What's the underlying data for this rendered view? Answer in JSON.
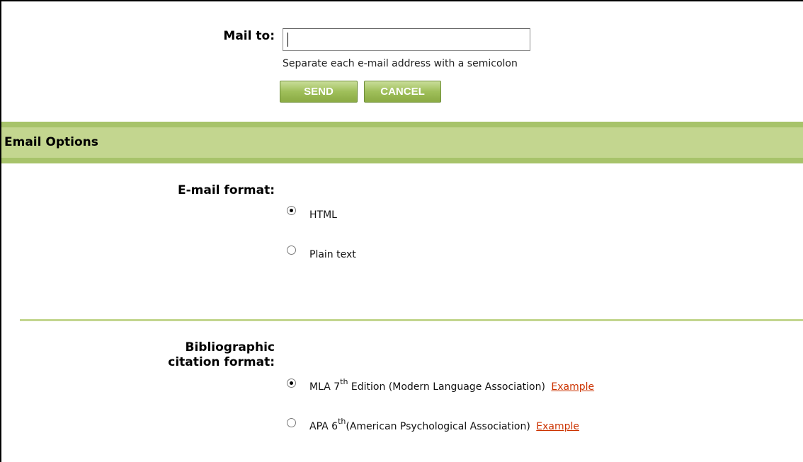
{
  "mail": {
    "label": "Mail to:",
    "value": "",
    "hint": "Separate each e-mail address with a semicolon",
    "send_label": "SEND",
    "cancel_label": "CANCEL"
  },
  "options": {
    "title": "Email Options",
    "format": {
      "label": "E-mail format:",
      "choices": [
        {
          "label": "HTML",
          "checked": true
        },
        {
          "label": "Plain text",
          "checked": false
        }
      ]
    },
    "citation": {
      "label_line1": "Bibliographic",
      "label_line2": "citation format:",
      "choices": [
        {
          "prefix": "MLA 7",
          "sup": "th",
          "suffix": " Edition (Modern Language Association)",
          "link": "Example",
          "checked": true
        },
        {
          "prefix": "APA 6",
          "sup": "th",
          "suffix": "(American Psychological Association)",
          "link": "Example",
          "checked": false
        }
      ]
    }
  },
  "colors": {
    "bar_dark": "#a7c36a",
    "bar_light": "#c3d68f",
    "button_green": "#9fbf5a",
    "link": "#cc3300"
  }
}
